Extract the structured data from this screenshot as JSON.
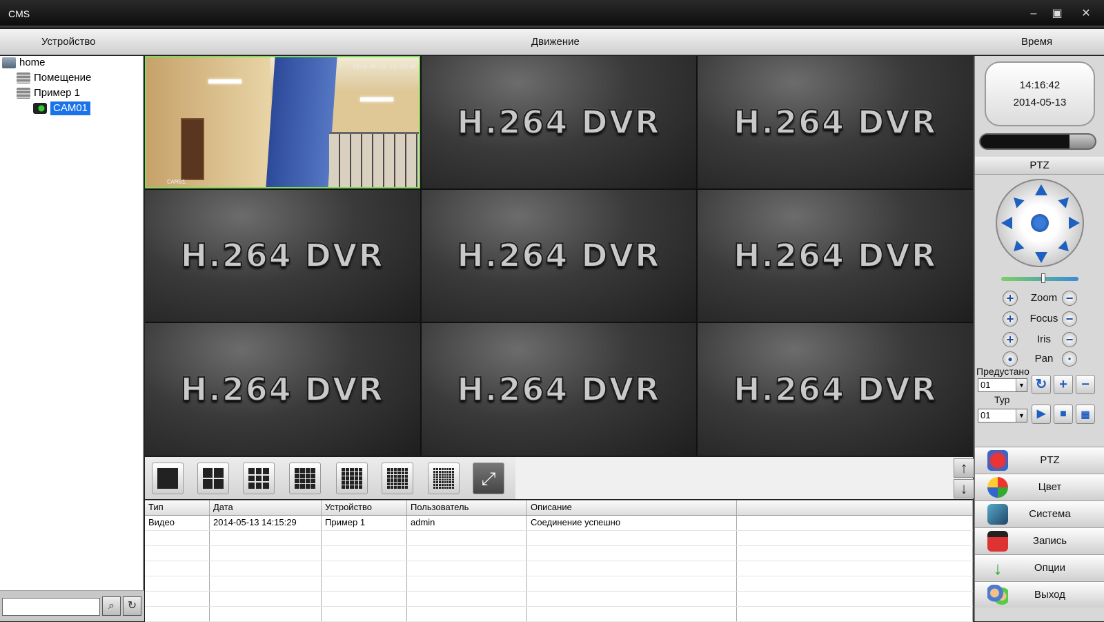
{
  "window": {
    "title": "CMS",
    "minimize_icon": "minimize-icon",
    "maximize_icon": "maximize-icon",
    "close_icon": "close-icon"
  },
  "header": {
    "device_label": "Устройство",
    "motion_label": "Движение",
    "time_label": "Время"
  },
  "tree": {
    "root": "home",
    "items": [
      "Помещение",
      "Пример 1",
      "CAM01"
    ],
    "search_placeholder": "",
    "search_icon": "search-icon",
    "refresh_icon": "refresh-icon"
  },
  "video": {
    "cells": [
      "",
      "H.264 DVR",
      "H.264 DVR",
      "H.264 DVR",
      "H.264 DVR",
      "H.264 DVR",
      "H.264 DVR",
      "H.264 DVR",
      "H.264 DVR"
    ],
    "live_timestamp": "2014-05-13 14:15:42",
    "live_camera": "CAM01"
  },
  "layout_buttons": [
    "layout-1-icon",
    "layout-4-icon",
    "layout-9-icon",
    "layout-16-icon",
    "layout-25-icon",
    "layout-36-icon",
    "layout-64-icon",
    "fullscreen-icon"
  ],
  "log": {
    "columns": [
      "Тип",
      "Дата",
      "Устройство",
      "Пользователь",
      "Описание"
    ],
    "rows": [
      [
        "Видео",
        "2014-05-13 14:15:29",
        "Пример 1",
        "admin",
        "Соединение успешно"
      ]
    ]
  },
  "clock": {
    "time": "14:16:42",
    "date": "2014-05-13"
  },
  "progress_fraction": 0.22,
  "ptz": {
    "title": "PTZ",
    "speed_fraction": 0.55,
    "controls": [
      "Zoom",
      "Focus",
      "Iris",
      "Pan"
    ],
    "preset_label": "Предустано",
    "preset_value": "01",
    "tour_label": "Тур",
    "tour_value": "01"
  },
  "menu": [
    "PTZ",
    "Цвет",
    "Система",
    "Запись",
    "Опции",
    "Выход"
  ],
  "colors": {
    "selection": "#1a73e8",
    "live_border": "#7fdc5a",
    "ptz_blue": "#1f5fc0"
  }
}
